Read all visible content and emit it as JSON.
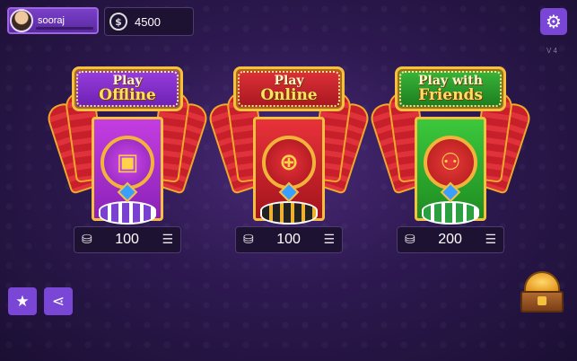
{
  "header": {
    "username": "sooraj",
    "coin_symbol": "$",
    "coins": "4500",
    "version": "V 4"
  },
  "modes": [
    {
      "line1": "Play",
      "line2": "Offline",
      "fee": "100",
      "theme": "purple",
      "icon": "monitor-user-icon"
    },
    {
      "line1": "Play",
      "line2": "Online",
      "fee": "100",
      "theme": "red",
      "icon": "globe-icon"
    },
    {
      "line1": "Play with",
      "line2": "Friends",
      "fee": "200",
      "theme": "green",
      "icon": "friends-icon"
    }
  ],
  "icons": {
    "settings": "gear-icon",
    "star": "star-icon",
    "share": "share-icon",
    "chest": "treasure-chest-icon",
    "coin_stack": "coin-stack-icon",
    "adjust": "sliders-icon"
  },
  "colors": {
    "accent": "#7a46d6",
    "gold": "#f5c040"
  }
}
